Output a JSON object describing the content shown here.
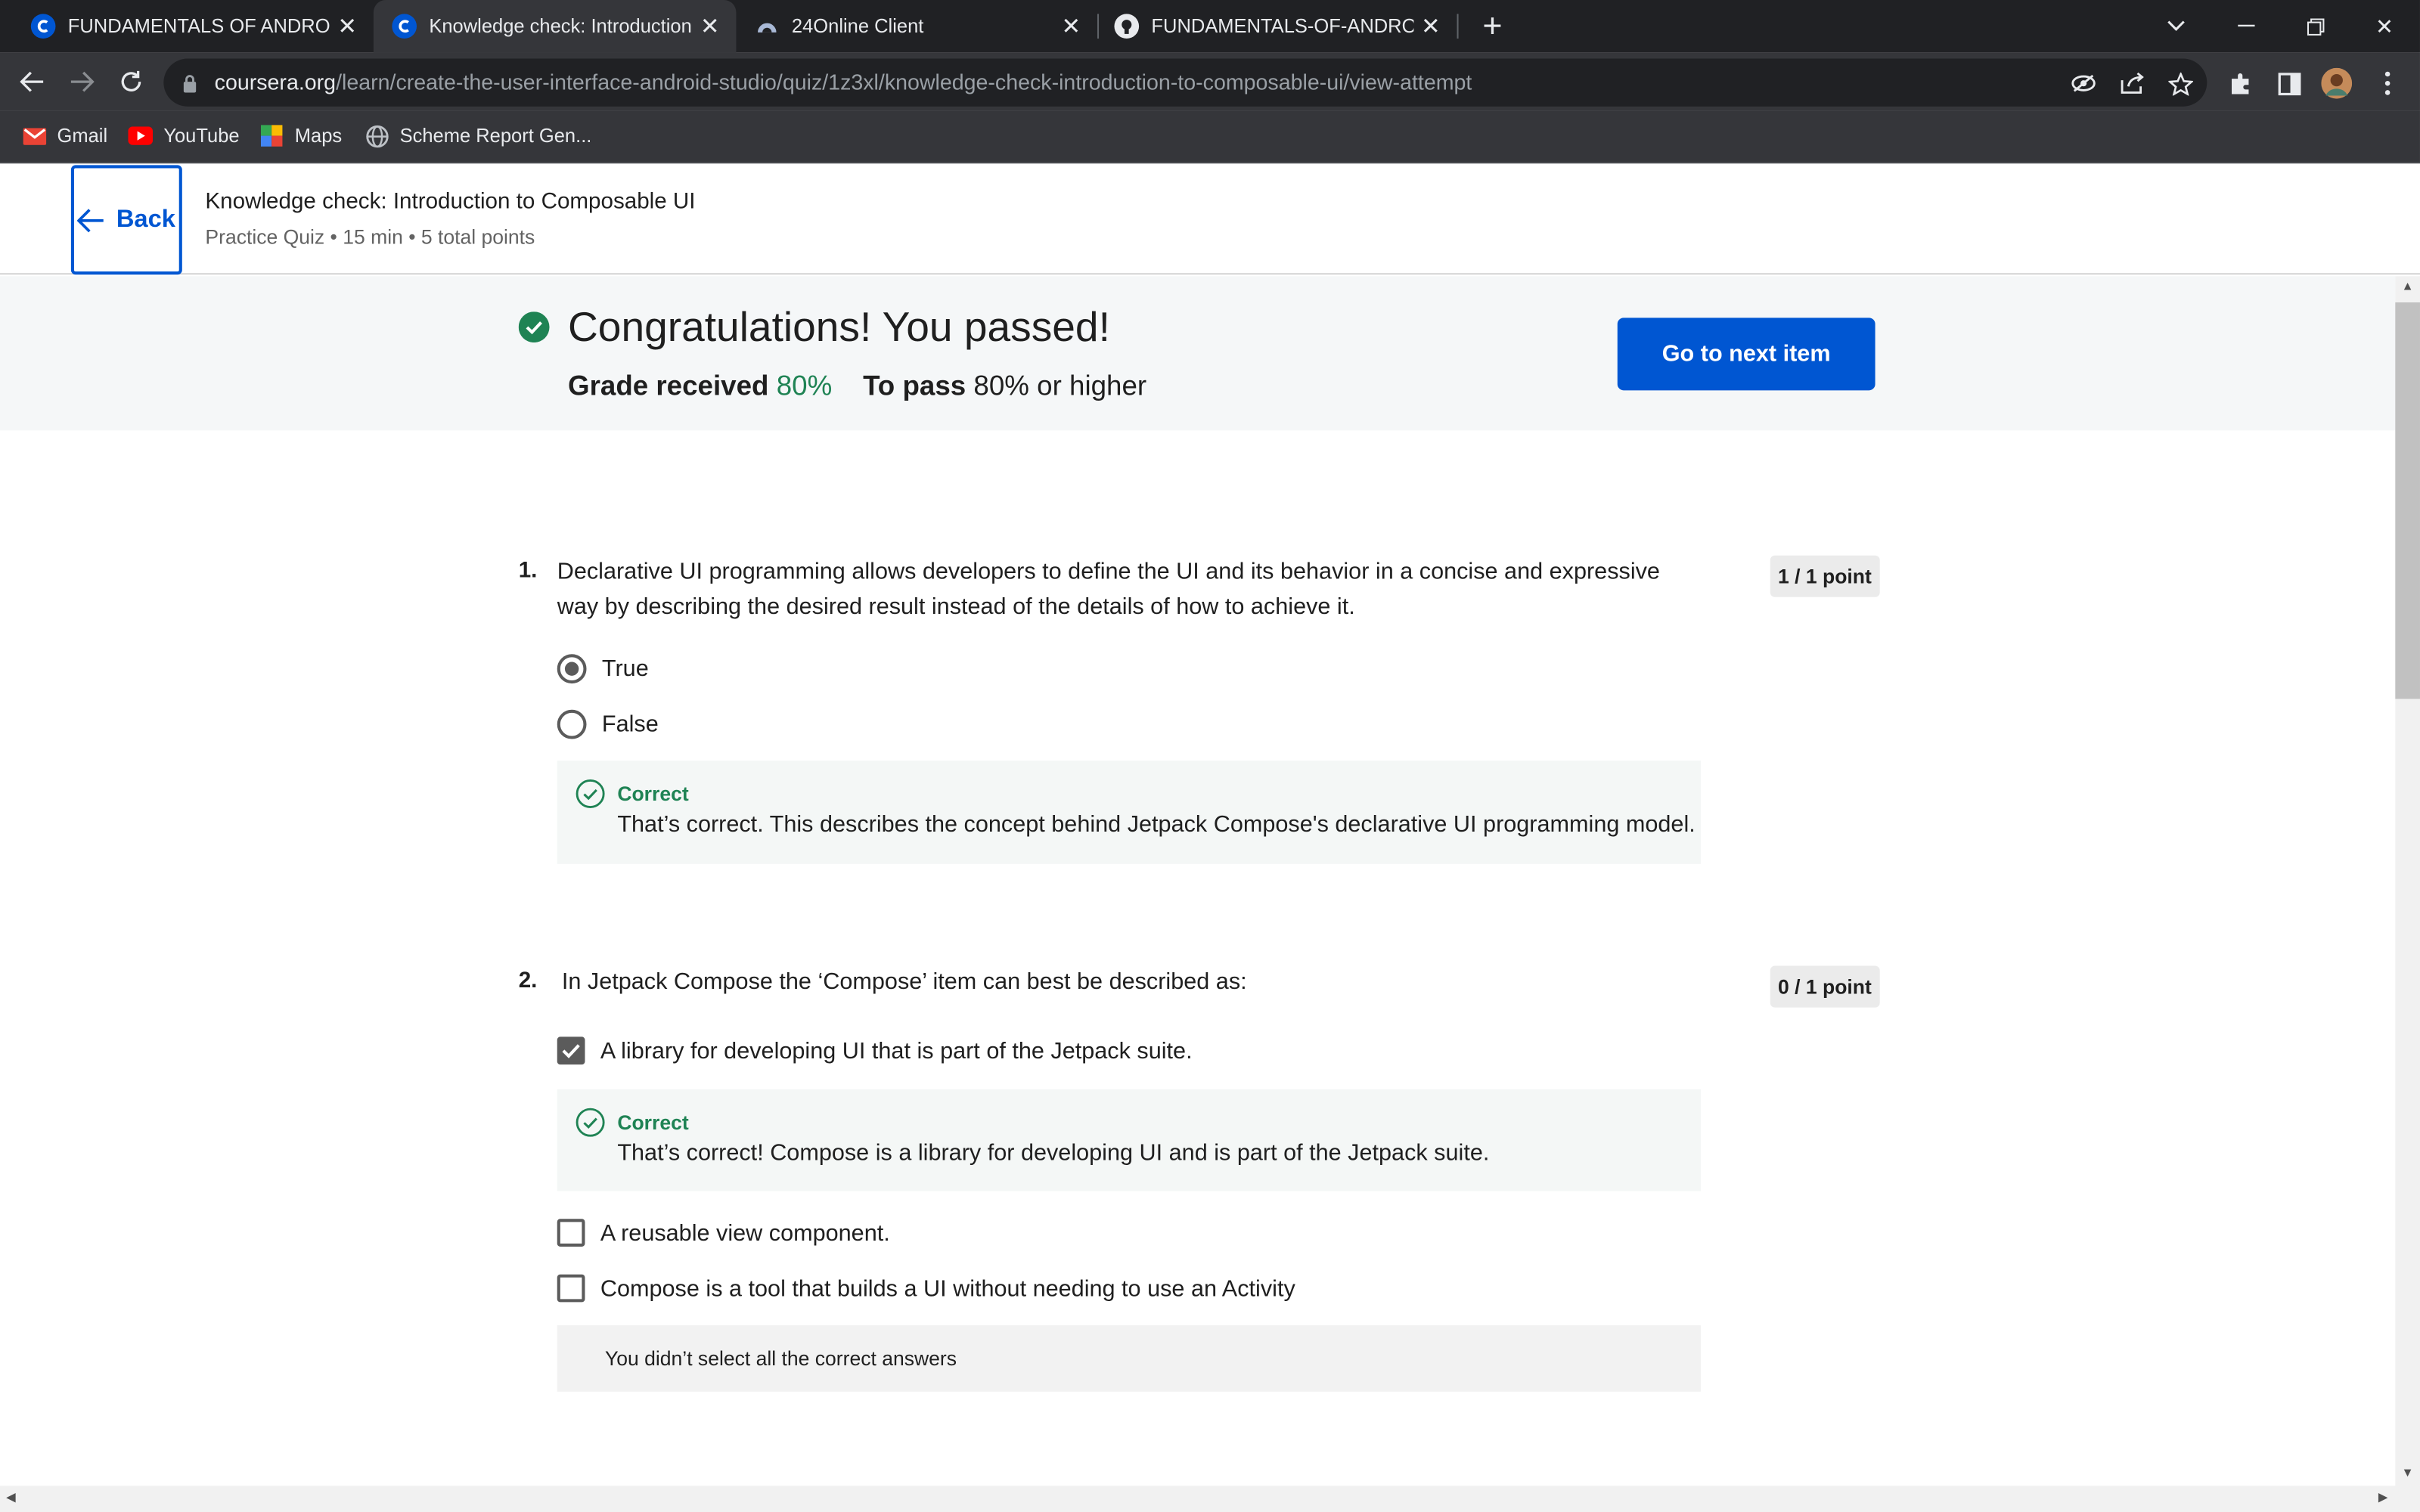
{
  "browser": {
    "tabs": [
      {
        "title": "FUNDAMENTALS OF ANDROID ::",
        "icon": "coursera-icon"
      },
      {
        "title": "Knowledge check: Introduction to",
        "icon": "coursera-icon"
      },
      {
        "title": "24Online Client",
        "icon": "cloud-icon"
      },
      {
        "title": "FUNDAMENTALS-OF-ANDROID-",
        "icon": "github-icon"
      }
    ],
    "url_host": "coursera.org",
    "url_path": "/learn/create-the-user-interface-android-studio/quiz/1z3xl/knowledge-check-introduction-to-composable-ui/view-attempt",
    "bookmarks": [
      {
        "label": "Gmail",
        "icon": "gmail-icon"
      },
      {
        "label": "YouTube",
        "icon": "youtube-icon"
      },
      {
        "label": "Maps",
        "icon": "maps-icon"
      },
      {
        "label": "Scheme Report Gen...",
        "icon": "globe-icon"
      }
    ]
  },
  "header": {
    "back_label": "Back",
    "title": "Knowledge check: Introduction to Composable UI",
    "subtitle": "Practice Quiz • 15 min • 5 total points"
  },
  "result": {
    "headline": "Congratulations! You passed!",
    "grade_label": "Grade received",
    "grade_value": "80%",
    "pass_label": "To pass",
    "pass_value": "80% or higher",
    "next_button": "Go to next item"
  },
  "questions": [
    {
      "number": "1.",
      "text": "Declarative UI programming allows developers to define the UI and its behavior in a concise and expressive way by describing the desired result instead of the details of how to achieve it.",
      "points": "1 / 1 point",
      "options": [
        {
          "label": "True",
          "selected": true
        },
        {
          "label": "False",
          "selected": false
        }
      ],
      "feedback_label": "Correct",
      "feedback_text": "That’s correct.  This describes the concept behind Jetpack Compose's declarative UI programming model."
    },
    {
      "number": "2.",
      "text": "In Jetpack Compose the ‘Compose’ item can best be described as:",
      "points": "0 / 1 point",
      "options": [
        {
          "label": "A library for developing UI that is part of the Jetpack suite.",
          "selected": true
        },
        {
          "label": "A reusable view component.",
          "selected": false
        },
        {
          "label": "Compose is a tool that builds a UI without needing to use an Activity",
          "selected": false
        }
      ],
      "feedback_label": "Correct",
      "feedback_text": "That’s correct! Compose is a library for developing UI and is part of the Jetpack suite.",
      "summary": "You didn’t select all the correct answers"
    }
  ],
  "colors": {
    "brand_blue": "#0056d2",
    "success_green": "#1f8354",
    "chrome_dark": "#202124"
  }
}
